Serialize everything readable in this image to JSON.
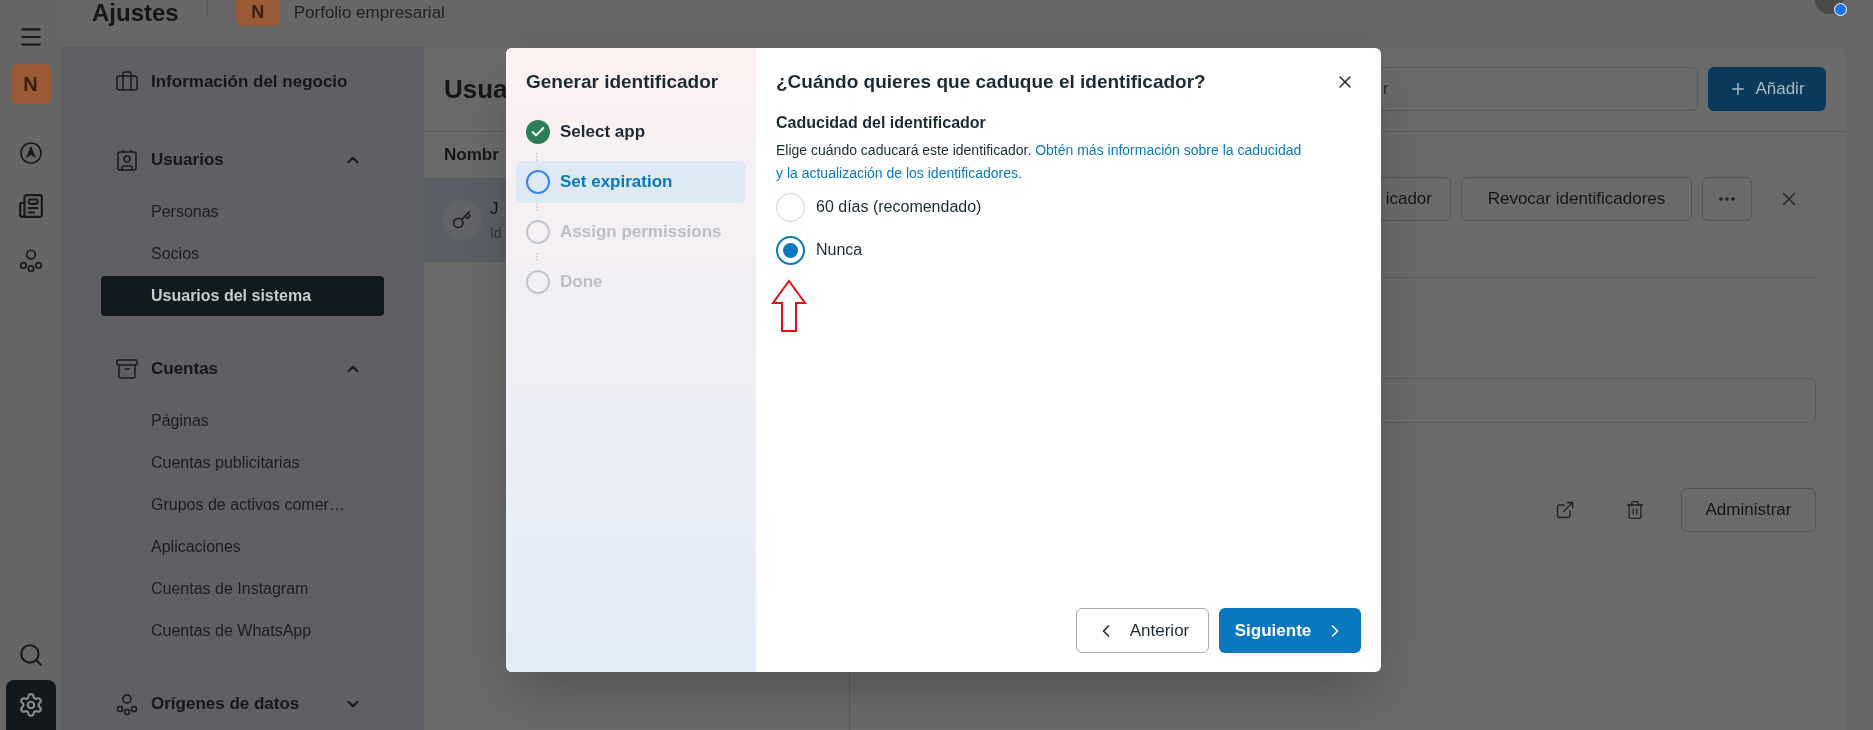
{
  "header": {
    "title": "Ajustes",
    "portfolio_initial": "N",
    "portfolio_name": "Porfolio empresarial"
  },
  "rail": {
    "avatar_initial": "N"
  },
  "sidebar": {
    "sections": [
      {
        "kind": "link",
        "label": "Información del negocio"
      },
      {
        "kind": "group",
        "label": "Usuarios",
        "expanded": true,
        "children": [
          {
            "label": "Personas",
            "selected": false
          },
          {
            "label": "Socios",
            "selected": false
          },
          {
            "label": "Usuarios del sistema",
            "selected": true
          }
        ]
      },
      {
        "kind": "group",
        "label": "Cuentas",
        "expanded": true,
        "children": [
          {
            "label": "Páginas",
            "selected": false
          },
          {
            "label": "Cuentas publicitarias",
            "selected": false
          },
          {
            "label": "Grupos de activos comer…",
            "selected": false
          },
          {
            "label": "Aplicaciones",
            "selected": false
          },
          {
            "label": "Cuentas de Instagram",
            "selected": false
          },
          {
            "label": "Cuentas de WhatsApp",
            "selected": false
          }
        ]
      },
      {
        "kind": "group",
        "label": "Orígenes de datos",
        "expanded": false
      }
    ]
  },
  "list_panel": {
    "title": "Usua",
    "column": "Nombr",
    "row": {
      "name": "J",
      "subtitle": "Id",
      "selected": true
    }
  },
  "detail": {
    "search_placeholder": "r",
    "add_button": "Añadir",
    "buttons": [
      "icador",
      "Revocar identificadores"
    ],
    "manage_button": "Administrar"
  },
  "modal": {
    "title": "Generar identificador",
    "steps": [
      {
        "label": "Select app",
        "done": true,
        "selected": false
      },
      {
        "label": "Set expiration",
        "done": false,
        "selected": true
      },
      {
        "label": "Assign permissions",
        "done": false,
        "selected": false
      },
      {
        "label": "Done",
        "done": false,
        "selected": false
      }
    ],
    "question": "¿Cuándo quieres que caduque el identificador?",
    "section_title": "Caducidad del identificador",
    "description": "Elige cuándo caducará este identificador.",
    "link_lines": [
      "Obtén más información sobre la caducidad",
      "y la actualización de los identificadores."
    ],
    "options": [
      {
        "label": "60 días (recomendado)",
        "selected": false
      },
      {
        "label": "Nunca",
        "selected": true
      }
    ],
    "prev_button": "Anterior",
    "next_button": "Siguiente"
  }
}
